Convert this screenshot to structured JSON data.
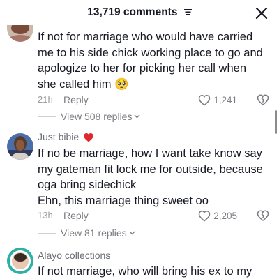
{
  "header": {
    "title": "13,719 comments",
    "sort_icon": "sort-lines-icon",
    "close_icon": "close-icon"
  },
  "comments": [
    {
      "username": "",
      "text_lines": [
        "If not for marriage who would have carried",
        "me to his side chick working place to go and",
        "apologize to her for picking her call when",
        "she called him 🥺"
      ],
      "time": "21h",
      "reply_label": "Reply",
      "likes": "1,241",
      "view_replies": "View 508 replies"
    },
    {
      "username": "Just bibie",
      "username_emoji": "red-heart",
      "text_lines": [
        "If no be marriage, how I want take know say",
        "my gateman fit lock me for outside, because",
        "oga bring sidechick",
        "Ehn, this marriage thing sweet oo"
      ],
      "time": "13h",
      "reply_label": "Reply",
      "likes": "2,205",
      "view_replies": "View 81 replies"
    },
    {
      "username": "Alayo collections",
      "text_lines": [
        "If not marriage, who will bring his ex to my"
      ]
    }
  ],
  "colors": {
    "text_primary": "#161823",
    "text_secondary": "#7a7c82",
    "heart_red": "#e0262f"
  }
}
